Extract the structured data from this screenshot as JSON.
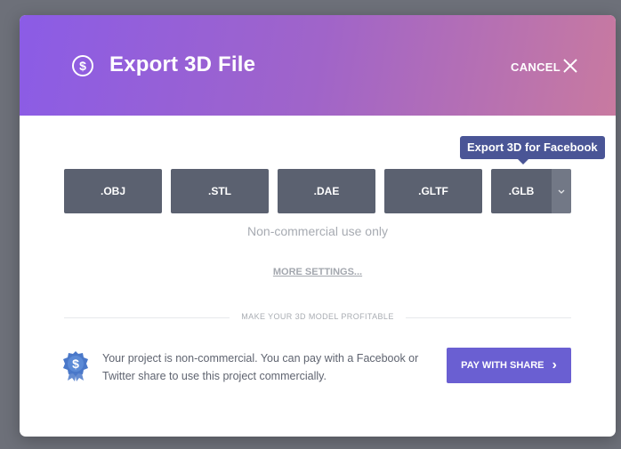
{
  "header": {
    "title": "Export 3D File",
    "icon": "dollar-circle-icon",
    "icon_glyph": "$",
    "cancel_label": "CANCEL"
  },
  "tooltip": "Export 3D for Facebook",
  "formats": [
    ".OBJ",
    ".STL",
    ".DAE",
    ".GLTF",
    ".GLB"
  ],
  "notice": "Non-commercial use only",
  "more_settings": "MORE SETTINGS...",
  "divider": "MAKE YOUR 3D MODEL PROFITABLE",
  "info_text": "Your project is non-commercial. You can pay with a Facebook or Twitter share to use this project commercially.",
  "badge_glyph": "$",
  "pay_button": {
    "label": "PAY WITH SHARE",
    "arrow": "›"
  },
  "colors": {
    "header_gradient_start": "#8b5ce6",
    "header_gradient_end": "#c87aa0",
    "format_button": "#5b6170",
    "tooltip": "#4a5596",
    "pay_button": "#6a5fd2",
    "badge": "#4a78c9"
  }
}
